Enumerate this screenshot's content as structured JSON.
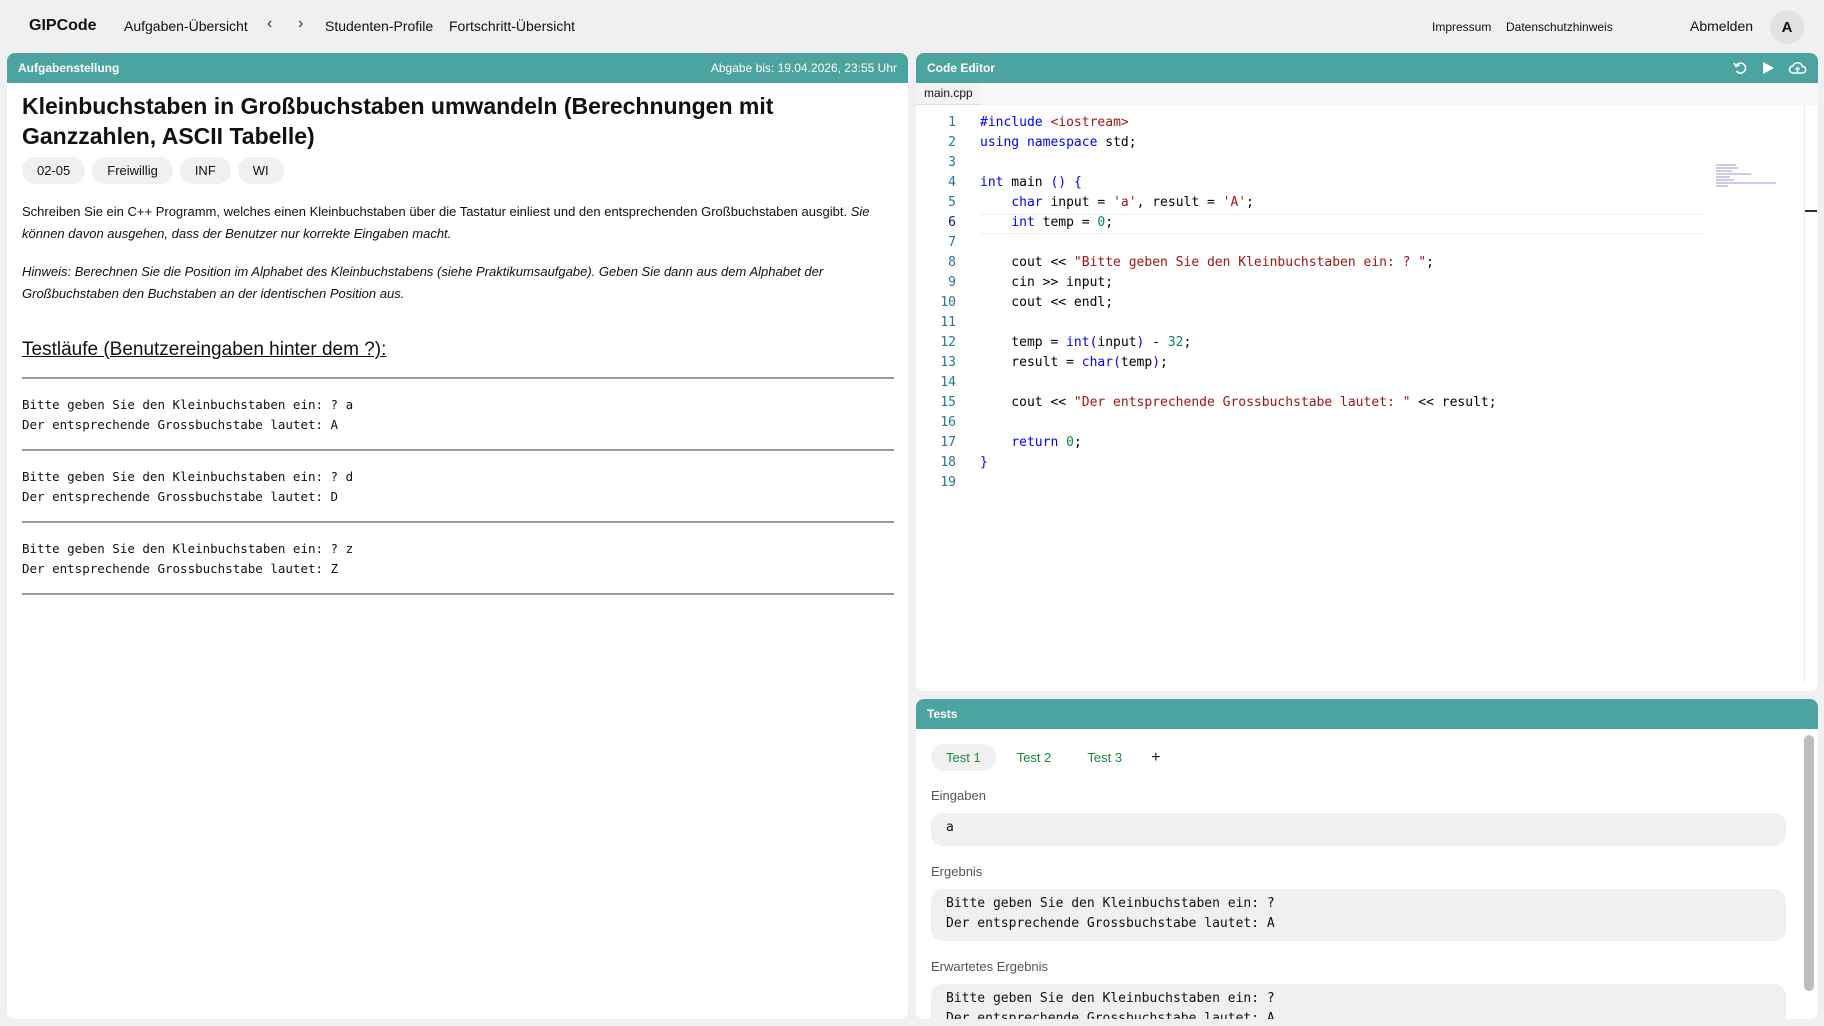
{
  "nav": {
    "brand": "GIPCode",
    "links": [
      "Aufgaben-Übersicht",
      "Studenten-Profile",
      "Fortschritt-Übersicht"
    ],
    "right_links": [
      "Impressum",
      "Datenschutzhinweis"
    ],
    "logout": "Abmelden",
    "avatar": "A",
    "back_arrow": "‹",
    "forward_arrow": "›"
  },
  "task": {
    "header": "Aufgabenstellung",
    "deadline": "Abgabe bis: 19.04.2026, 23:55 Uhr",
    "title": "Kleinbuchstaben in Großbuchstaben umwandeln (Berechnungen mit Ganzzahlen, ASCII Tabelle)",
    "tags": [
      "02-05",
      "Freiwillig",
      "INF",
      "WI"
    ],
    "description": "Schreiben Sie ein C++ Programm, welches einen Kleinbuchstaben über die Tastatur einliest und den entsprechenden Großbuchstaben ausgibt.",
    "description_italic": "Sie können davon ausgehen, dass der Benutzer nur korrekte Eingaben macht.",
    "hint": "Hinweis: Berechnen Sie die Position im Alphabet des Kleinbuchstabens (siehe Praktikumsaufgabe). Geben Sie dann aus dem Alphabet der Großbuchstaben den Buchstaben an der identischen Position aus.",
    "runs_title": "Testläufe (Benutzereingaben hinter dem ?):",
    "runs": [
      "Bitte geben Sie den Kleinbuchstaben ein: ? a\nDer entsprechende Grossbuchstabe lautet: A",
      "Bitte geben Sie den Kleinbuchstaben ein: ? d\nDer entsprechende Grossbuchstabe lautet: D",
      "Bitte geben Sie den Kleinbuchstaben ein: ? z\nDer entsprechende Grossbuchstabe lautet: Z"
    ]
  },
  "editor": {
    "header": "Code Editor",
    "file_tab": "main.cpp",
    "icons": [
      "undo-icon",
      "run-icon",
      "upload-cloud-icon"
    ],
    "lines": [
      "#include <iostream>",
      "using namespace std;",
      "",
      "int main () {",
      "    char input = 'a', result = 'A';",
      "    int temp = 0;",
      "",
      "    cout << \"Bitte geben Sie den Kleinbuchstaben ein: ? \";",
      "    cin >> input;",
      "    cout << endl;",
      "",
      "    temp = int(input) - 32;",
      "    result = char(temp);",
      "",
      "    cout << \"Der entsprechende Grossbuchstabe lautet: \" << result;",
      "",
      "    return 0;",
      "}",
      ""
    ],
    "active_line": 6
  },
  "tests": {
    "header": "Tests",
    "tabs": [
      "Test 1",
      "Test 2",
      "Test 3"
    ],
    "add_label": "+",
    "input_label": "Eingaben",
    "input_value": "a",
    "result_label": "Ergebnis",
    "result_value": "Bitte geben Sie den Kleinbuchstaben ein: ?\nDer entsprechende Grossbuchstabe lautet: A",
    "expected_label": "Erwartetes Ergebnis",
    "expected_value": "Bitte geben Sie den Kleinbuchstaben ein: ?\nDer entsprechende Grossbuchstabe lautet: A"
  }
}
